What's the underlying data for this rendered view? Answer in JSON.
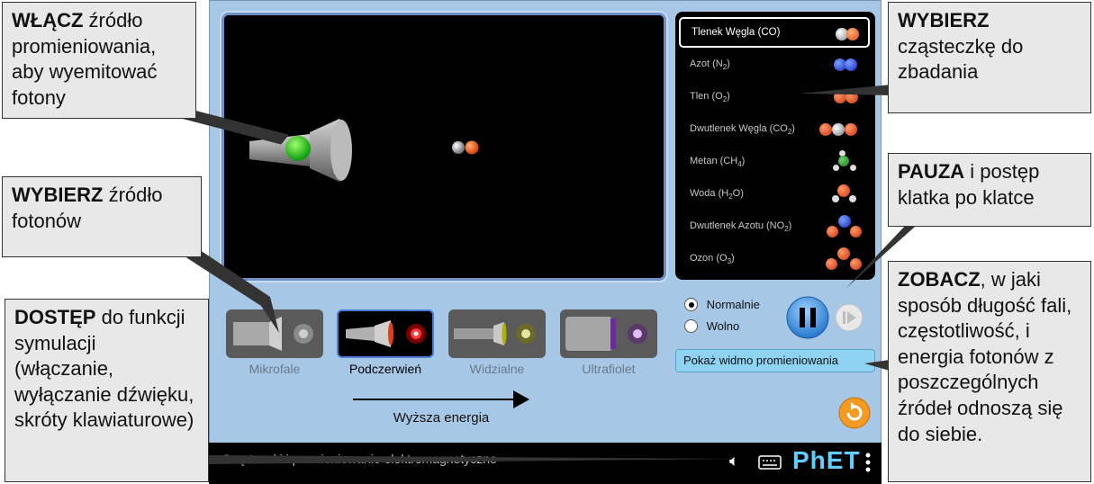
{
  "molecules": [
    {
      "label": "Tlenek Węgla (CO)",
      "selected": true
    },
    {
      "label": "Azot (N",
      "sub": "2",
      "tail": ")"
    },
    {
      "label": "Tlen (O",
      "sub": "2",
      "tail": ")"
    },
    {
      "label": "Dwutlenek Węgla (CO",
      "sub": "2",
      "tail": ")"
    },
    {
      "label": "Metan (CH",
      "sub": "4",
      "tail": ")"
    },
    {
      "label": "Woda (H",
      "sub": "2",
      "tail": "O)"
    },
    {
      "label": "Dwutlenek Azotu (NO",
      "sub": "2",
      "tail": ")"
    },
    {
      "label": "Ozon (O",
      "sub": "3",
      "tail": ")"
    }
  ],
  "sources": [
    {
      "label": "Mikrofale"
    },
    {
      "label": "Podczerwień",
      "selected": true
    },
    {
      "label": "Widzialne"
    },
    {
      "label": "Ultrafiolet"
    }
  ],
  "energy_label": "Wyższa energia",
  "speed": {
    "normal": "Normalnie",
    "slow": "Wolno",
    "selected": "Normalnie"
  },
  "spectrum_button": "Pokaż widmo promieniowania",
  "navbar": {
    "title": "Cząsteczki i promieniowanie elektromagnetyczne",
    "logo": "PhET"
  },
  "callouts": {
    "emit": {
      "bold": "WŁĄCZ",
      "text": " źródło promieniowania, aby wyemitować fotony"
    },
    "source": {
      "bold": "WYBIERZ",
      "text": " źródło fotonów"
    },
    "access": {
      "bold": "DOSTĘP",
      "text": " do funkcji symulacji (włączanie, wyłączanie dźwięku, skróty klawiaturowe)"
    },
    "choose_molecule": {
      "bold": "WYBIERZ",
      "text": " cząsteczkę do zbadania"
    },
    "pause": {
      "bold": "PAUZA",
      "text": " i postęp klatka po klatce"
    },
    "see": {
      "bold": "ZOBACZ",
      "text": ", w jaki sposób długość fali, częstotliwość, i energia fotonów z poszczególnych źródeł odnoszą się do siebie."
    }
  },
  "colors": {
    "sim_bg": "#a7c7e6",
    "accent": "#4a7bd6",
    "play": "#2e7fd6",
    "reset": "#f28c1a"
  }
}
